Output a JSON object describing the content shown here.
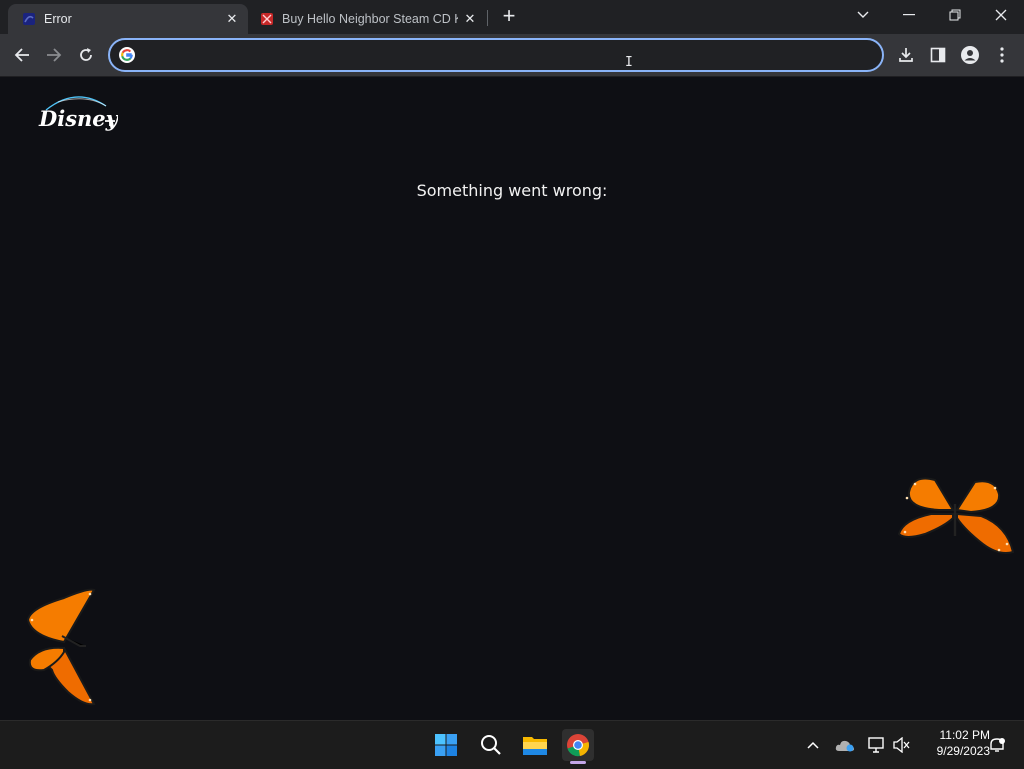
{
  "browser": {
    "tabs": [
      {
        "title": "Error",
        "active": true
      },
      {
        "title": "Buy Hello Neighbor Steam CD Key",
        "active": false
      }
    ],
    "address_bar": {
      "value": "",
      "placeholder": ""
    },
    "accent_color": "#8ab4f8"
  },
  "page": {
    "error_message": "Something went wrong:",
    "logo_text": "Disney+",
    "background_color": "#0e0f14"
  },
  "taskbar": {
    "pinned": [
      "start-icon",
      "search-icon",
      "file-explorer-icon",
      "chrome-icon"
    ],
    "time": "11:02 PM",
    "date": "9/29/2023"
  }
}
